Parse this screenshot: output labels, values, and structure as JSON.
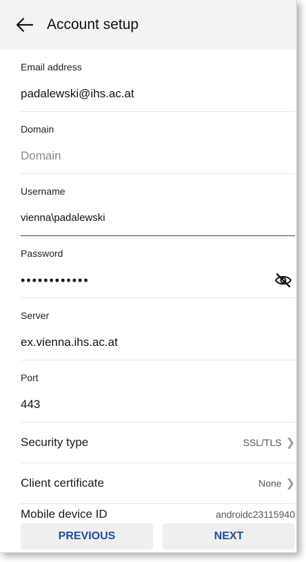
{
  "header": {
    "title": "Account setup"
  },
  "fields": {
    "email": {
      "label": "Email address",
      "value": "padalewski@ihs.ac.at"
    },
    "domain": {
      "label": "Domain",
      "placeholder": "Domain"
    },
    "username": {
      "label": "Username",
      "value": "vienna\\padalewski"
    },
    "password": {
      "label": "Password",
      "value": "••••••••••••"
    },
    "server": {
      "label": "Server",
      "value": "ex.vienna.ihs.ac.at"
    },
    "port": {
      "label": "Port",
      "value": "443"
    }
  },
  "settings": {
    "security": {
      "label": "Security type",
      "value": "SSL/TLS"
    },
    "certificate": {
      "label": "Client certificate",
      "value": "None"
    },
    "device": {
      "label": "Mobile device ID",
      "value": "androidc23115940"
    }
  },
  "buttons": {
    "previous": "PREVIOUS",
    "next": "NEXT"
  },
  "colors": {
    "accent": "#1c4fa0",
    "appbar": "#f3f3f3"
  },
  "icons": {
    "back": "arrow-left",
    "visibility": "eye-off"
  }
}
